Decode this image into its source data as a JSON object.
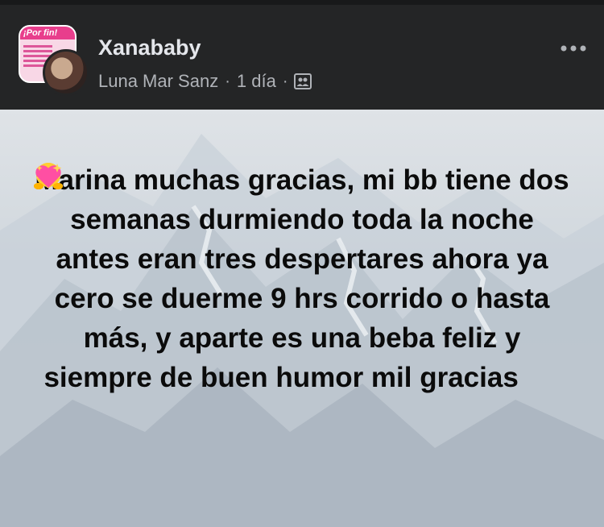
{
  "post": {
    "group_name": "Xanababy",
    "author": "Luna Mar Sanz",
    "time": "1 día",
    "separator": "·",
    "more_icon": "more-horizontal-icon",
    "privacy_icon": "group-icon",
    "group_thumb_banner": "¡Por fin!",
    "text": "Marina muchas gracias, mi bb tiene dos semanas durmiendo toda la noche antes eran tres despertares ahora ya cero se duerme 9 hrs corrido o hasta más, y aparte es una beba feliz y siempre de buen humor mil gracias",
    "emojis": [
      "hugging-face-icon",
      "hugging-face-icon",
      "heart-with-ribbon-icon",
      "sparkling-heart-icon"
    ]
  },
  "colors": {
    "header_bg": "#242526",
    "title_text": "#e4e6eb",
    "meta_text": "#b0b3b8",
    "post_text": "#0b0b0b"
  }
}
